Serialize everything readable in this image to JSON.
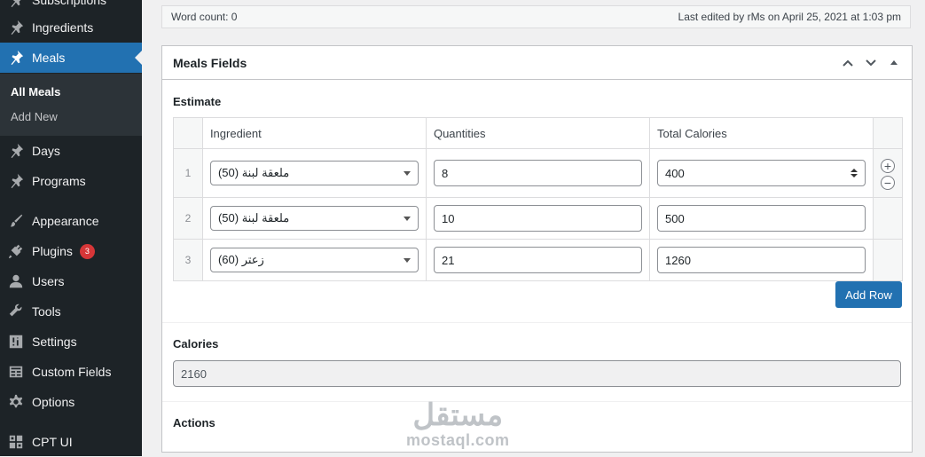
{
  "sidebar": {
    "items": [
      {
        "label": "Subscriptions",
        "icon": "pin-icon"
      },
      {
        "label": "Ingredients",
        "icon": "pin-icon"
      },
      {
        "label": "Meals",
        "icon": "pin-icon"
      },
      {
        "label": "Days",
        "icon": "pin-icon"
      },
      {
        "label": "Programs",
        "icon": "pin-icon"
      },
      {
        "label": "Appearance",
        "icon": "brush-icon"
      },
      {
        "label": "Plugins",
        "icon": "plug-icon",
        "badge": "3"
      },
      {
        "label": "Users",
        "icon": "user-icon"
      },
      {
        "label": "Tools",
        "icon": "wrench-icon"
      },
      {
        "label": "Settings",
        "icon": "sliders-icon"
      },
      {
        "label": "Custom Fields",
        "icon": "table-icon"
      },
      {
        "label": "Options",
        "icon": "gear-icon"
      },
      {
        "label": "CPT UI",
        "icon": "grid-icon"
      }
    ],
    "submenu": [
      {
        "label": "All Meals"
      },
      {
        "label": "Add New"
      }
    ]
  },
  "statusbar": {
    "word_count": "Word count: 0",
    "last_edited": "Last edited by rMs on April 25, 2021 at 1:03 pm"
  },
  "metabox": {
    "title": "Meals Fields",
    "estimate_label": "Estimate",
    "columns": [
      "Ingredient",
      "Quantities",
      "Total Calories"
    ],
    "rows": [
      {
        "num": "1",
        "ingredient": "ملعقة لبنة (50)",
        "quantity": "8",
        "calories": "400"
      },
      {
        "num": "2",
        "ingredient": "ملعقة لبنة (50)",
        "quantity": "10",
        "calories": "500"
      },
      {
        "num": "3",
        "ingredient": "زعتر (60)",
        "quantity": "21",
        "calories": "1260"
      }
    ],
    "add_row_label": "Add Row",
    "calories_label": "Calories",
    "calories_value": "2160",
    "actions_label": "Actions"
  },
  "watermark": {
    "arabic": "مستقل",
    "latin": "mostaql.com"
  },
  "colors": {
    "sidebar_bg": "#1d2327",
    "accent": "#2271b1",
    "badge": "#d63638"
  }
}
